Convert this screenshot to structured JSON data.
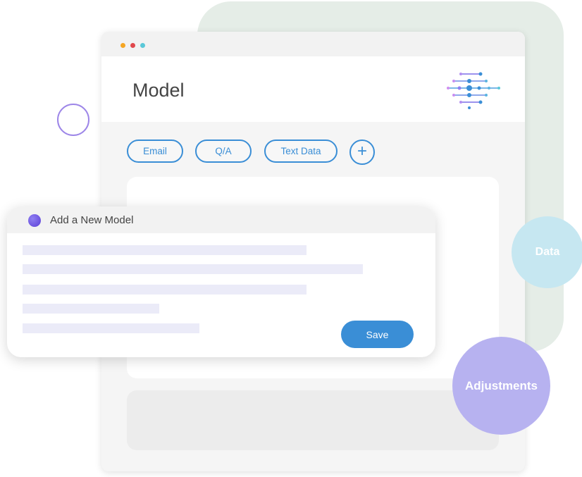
{
  "window": {
    "title": "Model",
    "dot_colors": [
      "#f5a623",
      "#e0474c",
      "#5ac8d8"
    ]
  },
  "chips": [
    "Email",
    "Q/A",
    "Text Data"
  ],
  "add_chip_label": "+",
  "dialog": {
    "title": "Add a New Model",
    "save_label": "Save"
  },
  "circles": {
    "data": "Data",
    "adjustments": "Adjustments"
  },
  "colors": {
    "accent": "#3a8ed6",
    "data_circle": "#c6e7f1",
    "adjustments_circle": "#b7b2f0",
    "ring": "#9d86e8"
  }
}
